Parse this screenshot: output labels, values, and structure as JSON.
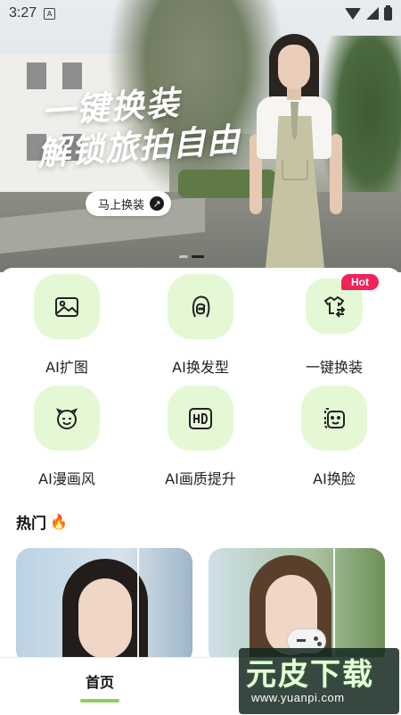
{
  "status_bar": {
    "time": "3:27",
    "notification_icon": "A"
  },
  "banner": {
    "headline_line1": "一键换装",
    "headline_line2": "解锁旅拍自由",
    "cta_label": "马上换装",
    "cta_icon": "arrow-up-right-icon",
    "cta_arrow_glyph": "↗",
    "slide_count": 2,
    "active_slide": 2
  },
  "features": [
    {
      "label": "AI扩图",
      "icon": "image-expand-icon"
    },
    {
      "label": "AI换发型",
      "icon": "hairstyle-icon"
    },
    {
      "label": "一键换装",
      "icon": "outfit-swap-icon",
      "badge": "Hot"
    },
    {
      "label": "AI漫画风",
      "icon": "comic-face-icon"
    },
    {
      "label": "AI画质提升",
      "icon": "hd-icon"
    },
    {
      "label": "AI换脸",
      "icon": "face-swap-icon"
    }
  ],
  "hot_section": {
    "title": "热门",
    "icon": "fire-icon",
    "fire_glyph": "🔥"
  },
  "bottom_nav": {
    "home_label": "首页"
  },
  "watermark": {
    "text": "元皮下载",
    "url": "www.yuanpi.com"
  },
  "colors": {
    "feature_tile_bg": "#e4f8d6",
    "accent_green": "#8ed05e",
    "hot_badge": "#f0245a"
  }
}
